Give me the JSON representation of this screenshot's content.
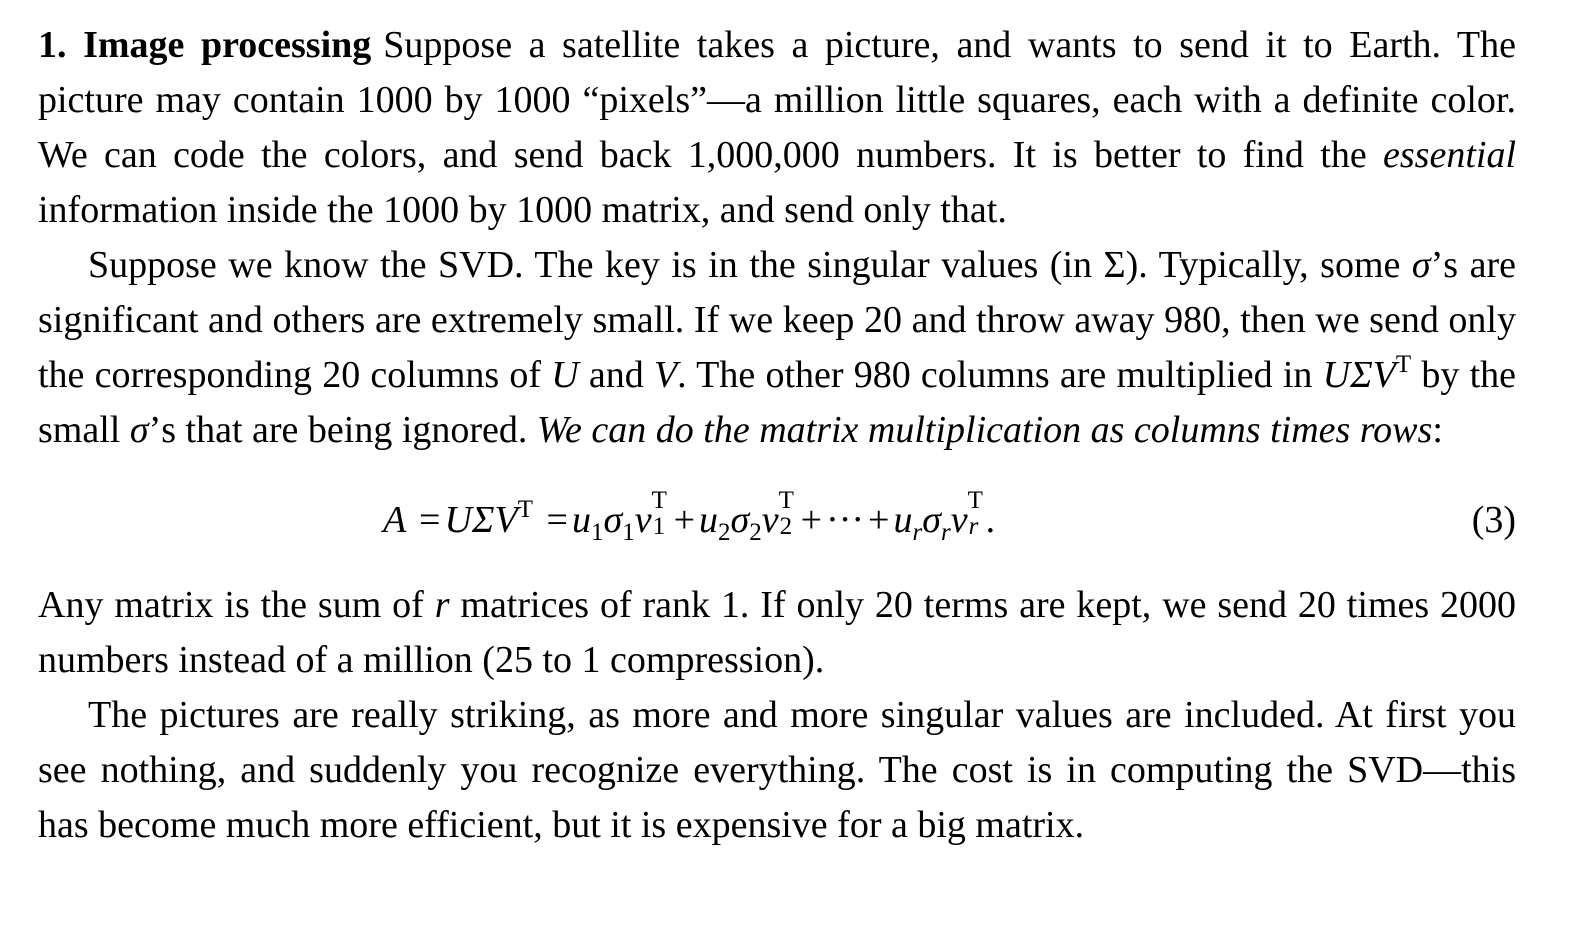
{
  "heading": "1. Image processing",
  "p1": {
    "text": "Suppose a satellite takes a picture, and wants to send it to Earth. The picture may contain 1000 by 1000 “pixels”—a million little squares, each with a definite color. We can code the colors, and send back 1,000,000 numbers. It is better to find the ",
    "emph": "essential",
    "text2": " information inside the 1000 by 1000 matrix, and send only that."
  },
  "p2": {
    "t1": "Suppose we know the SVD. The key is in the singular values (in Σ). Typically, some ",
    "sigma1": "σ",
    "t2": "’s are significant and others are extremely small. If we keep 20 and throw away 980, then we send only the corresponding 20 columns of ",
    "U": "U",
    "t3": " and ",
    "V": "V",
    "t4": ". The other 980 columns are multiplied in ",
    "usv": "UΣV",
    "T": "T",
    "t5": " by the small ",
    "sigma2": "σ",
    "t6": "’s that are being ignored. ",
    "emph": "We can do the matrix multiplication as columns times rows",
    "t7": ":"
  },
  "equation": {
    "A": "A",
    "eq1": "=",
    "UEV": "UΣV",
    "T": "T",
    "eq2": "=",
    "u": "u",
    "sigma": "σ",
    "v": "v",
    "n1": "1",
    "n2": "2",
    "r": "r",
    "plus": "+",
    "dots": "···",
    "period": ".",
    "number": "(3)"
  },
  "p3": {
    "t1": "Any matrix is the sum of ",
    "r": "r",
    "t2": " matrices of rank 1. If only 20 terms are kept, we send 20 times 2000 numbers instead of a million (25 to 1 compression)."
  },
  "p4": {
    "text": "The pictures are really striking, as more and more singular values are included. At first you see nothing, and suddenly you recognize everything. The cost is in computing the SVD—this has become much more efficient, but it is expensive for a big matrix."
  }
}
